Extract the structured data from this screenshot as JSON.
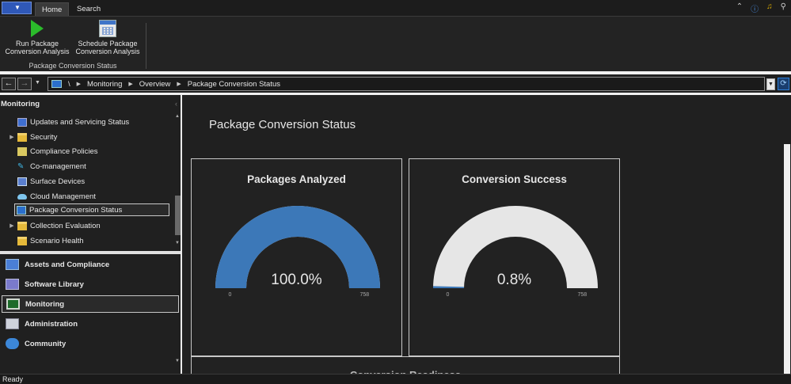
{
  "tabs": [
    {
      "label": "Home",
      "active": true
    },
    {
      "label": "Search",
      "active": false
    }
  ],
  "ribbon": {
    "run_label_1": "Run Package",
    "run_label_2": "Conversion Analysis",
    "schedule_label_1": "Schedule Package",
    "schedule_label_2": "Conversion Analysis",
    "group_label": "Package Conversion Status"
  },
  "top_icons": [
    "up-icon",
    "help-icon",
    "bell-icon",
    "user-icon"
  ],
  "breadcrumb": {
    "root": "\\",
    "items": [
      "Monitoring",
      "Overview",
      "Package Conversion Status"
    ]
  },
  "nav": {
    "title": "Monitoring",
    "tree": [
      {
        "label": "Updates and Servicing Status",
        "icon": "updates-icon",
        "expandable": false
      },
      {
        "label": "Security",
        "icon": "folder-icon",
        "expandable": true
      },
      {
        "label": "Compliance Policies",
        "icon": "compliance-icon",
        "expandable": false
      },
      {
        "label": "Co-management",
        "icon": "co-management-icon",
        "expandable": false
      },
      {
        "label": "Surface Devices",
        "icon": "surface-icon",
        "expandable": false
      },
      {
        "label": "Cloud Management",
        "icon": "cloud-icon",
        "expandable": false
      },
      {
        "label": "Package Conversion Status",
        "icon": "package-status-icon",
        "expandable": false,
        "selected": true
      },
      {
        "label": "Collection Evaluation",
        "icon": "folder-icon",
        "expandable": true
      },
      {
        "label": "Scenario Health",
        "icon": "scenario-icon",
        "expandable": false
      }
    ],
    "workspaces": [
      {
        "label": "Assets and Compliance",
        "icon": "assets-icon"
      },
      {
        "label": "Software Library",
        "icon": "library-icon"
      },
      {
        "label": "Monitoring",
        "icon": "monitoring-icon",
        "selected": true
      },
      {
        "label": "Administration",
        "icon": "administration-icon"
      },
      {
        "label": "Community",
        "icon": "community-icon"
      }
    ]
  },
  "content": {
    "title": "Package Conversion Status",
    "cards": [
      {
        "title": "Packages Analyzed",
        "value": "100.0%",
        "fraction": 1.0,
        "min": "0",
        "max": "758",
        "color": "#3c78b8"
      },
      {
        "title": "Conversion Success",
        "value": "0.8%",
        "fraction": 0.008,
        "min": "0",
        "max": "758",
        "color": "#3c78b8"
      }
    ],
    "bottom_card_title": "Conversion Readiness"
  },
  "colors": {
    "track": "#e6e6e6",
    "fill": "#3c78b8"
  },
  "status": "Ready"
}
